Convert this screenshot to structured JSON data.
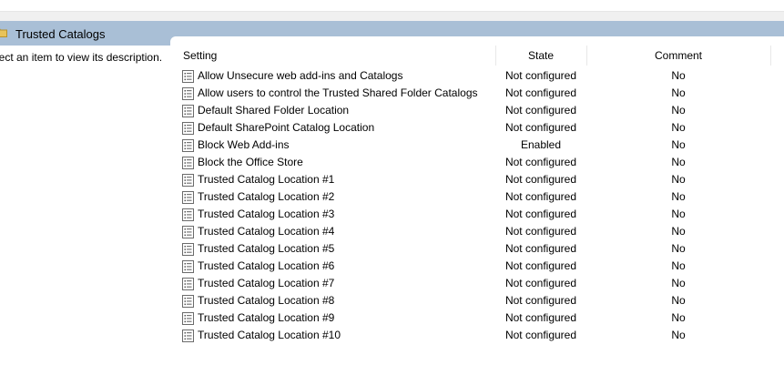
{
  "header": {
    "title": "Trusted Catalogs"
  },
  "left_pane": {
    "description": "lect an item to view its description."
  },
  "columns": {
    "setting": "Setting",
    "state": "State",
    "comment": "Comment"
  },
  "icons": {
    "folder": "folder-icon",
    "policy": "policy-setting-icon"
  },
  "colors": {
    "header_bar": "#a9bfd6",
    "folder": "#e8c35a"
  },
  "rows": [
    {
      "setting": "Allow Unsecure web add-ins and Catalogs",
      "state": "Not configured",
      "comment": "No"
    },
    {
      "setting": "Allow users to control the Trusted Shared Folder Catalogs",
      "state": "Not configured",
      "comment": "No"
    },
    {
      "setting": "Default Shared Folder Location",
      "state": "Not configured",
      "comment": "No"
    },
    {
      "setting": "Default SharePoint Catalog Location",
      "state": "Not configured",
      "comment": "No"
    },
    {
      "setting": "Block Web Add-ins",
      "state": "Enabled",
      "comment": "No"
    },
    {
      "setting": "Block the Office Store",
      "state": "Not configured",
      "comment": "No"
    },
    {
      "setting": "Trusted Catalog Location #1",
      "state": "Not configured",
      "comment": "No"
    },
    {
      "setting": "Trusted Catalog Location #2",
      "state": "Not configured",
      "comment": "No"
    },
    {
      "setting": "Trusted Catalog Location #3",
      "state": "Not configured",
      "comment": "No"
    },
    {
      "setting": "Trusted Catalog Location #4",
      "state": "Not configured",
      "comment": "No"
    },
    {
      "setting": "Trusted Catalog Location #5",
      "state": "Not configured",
      "comment": "No"
    },
    {
      "setting": "Trusted Catalog Location #6",
      "state": "Not configured",
      "comment": "No"
    },
    {
      "setting": "Trusted Catalog Location #7",
      "state": "Not configured",
      "comment": "No"
    },
    {
      "setting": "Trusted Catalog Location #8",
      "state": "Not configured",
      "comment": "No"
    },
    {
      "setting": "Trusted Catalog Location #9",
      "state": "Not configured",
      "comment": "No"
    },
    {
      "setting": "Trusted Catalog Location #10",
      "state": "Not configured",
      "comment": "No"
    }
  ]
}
